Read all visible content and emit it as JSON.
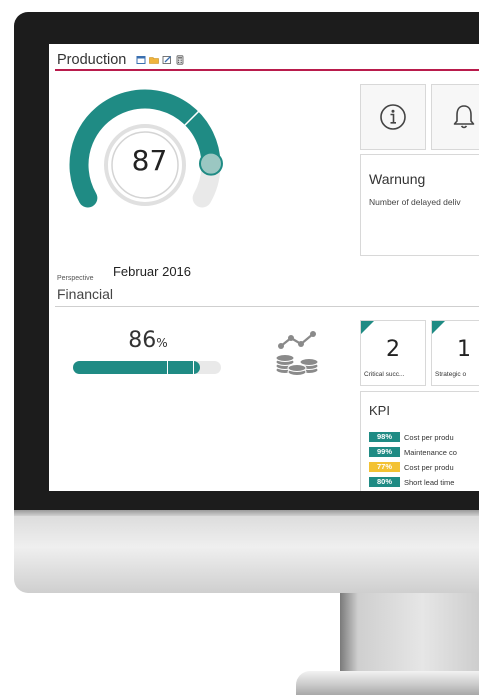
{
  "header": {
    "title": "Production"
  },
  "gauge": {
    "value": "87",
    "date": "Februar 2016",
    "fill_fraction": 0.87
  },
  "warning": {
    "title": "Warnung",
    "text": "Number of delayed deliv"
  },
  "perspective": {
    "label": "Perspective",
    "value": "Financial"
  },
  "progress": {
    "value": "86",
    "unit": "%",
    "fraction": 0.86
  },
  "tiles": [
    {
      "value": "2",
      "caption": "Critical succ..."
    },
    {
      "value": "1",
      "caption": "Strategic o"
    }
  ],
  "kpi": {
    "title": "KPI",
    "rows": [
      {
        "badge": "98%",
        "label": "Cost per produ",
        "color": "#1f8b84"
      },
      {
        "badge": "99%",
        "label": "Maintenance co",
        "color": "#1f8b84"
      },
      {
        "badge": "77%",
        "label": "Cost per produ",
        "color": "#f3c233"
      },
      {
        "badge": "80%",
        "label": "Short lead time",
        "color": "#1f8b84"
      }
    ]
  },
  "colors": {
    "accent": "#1f8b84",
    "header_line": "#b91b4c",
    "warning_badge": "#f3c233"
  },
  "icons": [
    "window-icon",
    "folder-icon",
    "edit-icon",
    "calculator-icon",
    "info-icon",
    "bell-icon",
    "coins-chart-icon"
  ]
}
